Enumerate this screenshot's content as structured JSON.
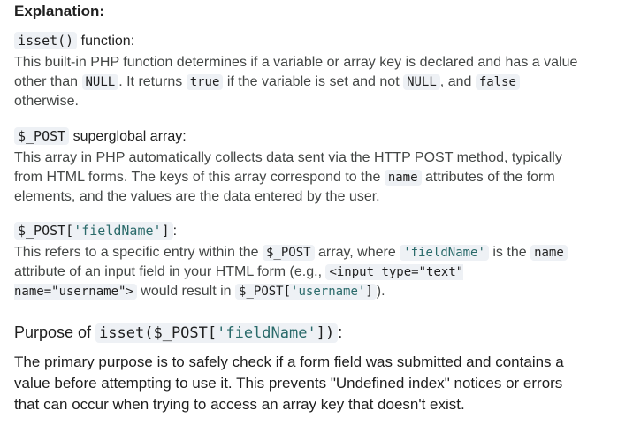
{
  "heading": "Explanation:",
  "items": [
    {
      "code": "isset()",
      "label": " function:",
      "desc": {
        "p1": "This built-in PHP function determines if a variable or array key is declared and has a value other than ",
        "c1": "NULL",
        "p2": ". It returns ",
        "c2": "true",
        "p3": " if the variable is set and not ",
        "c3": "NULL",
        "p4": ", and ",
        "c4": "false",
        "p5": " otherwise."
      }
    },
    {
      "code": "$_POST",
      "label": " superglobal array:",
      "desc": {
        "p1": "This array in PHP automatically collects data sent via the HTTP POST method, typically from HTML forms. The keys of this array correspond to the ",
        "c1": "name",
        "p2": " attributes of the form elements, and the values are the data entered by the user."
      }
    },
    {
      "code_a": "$_POST[",
      "code_str": "'fieldName'",
      "code_b": "]",
      "label": ":",
      "desc": {
        "p1": "This refers to a specific entry within the ",
        "c1": "$_POST",
        "p2": " array, where ",
        "c2": "'fieldName'",
        "p3": " is the ",
        "c3": "name",
        "p4": " attribute of an input field in your HTML form (e.g., ",
        "c4": "<input type=\"text\" name=\"username\">",
        "p5": " would result in ",
        "c5a": "$_POST[",
        "c5s": "'username'",
        "c5b": "]",
        "p6": ")."
      }
    }
  ],
  "purpose": {
    "prefix": "Purpose of ",
    "code_a": "isset($_POST[",
    "code_str": "'fieldName'",
    "code_b": "])",
    "suffix": ":",
    "text": "The primary purpose is to safely check if a form field was submitted and contains a value before attempting to use it. This prevents \"Undefined index\" notices or errors that can occur when trying to access an array key that doesn't exist."
  }
}
